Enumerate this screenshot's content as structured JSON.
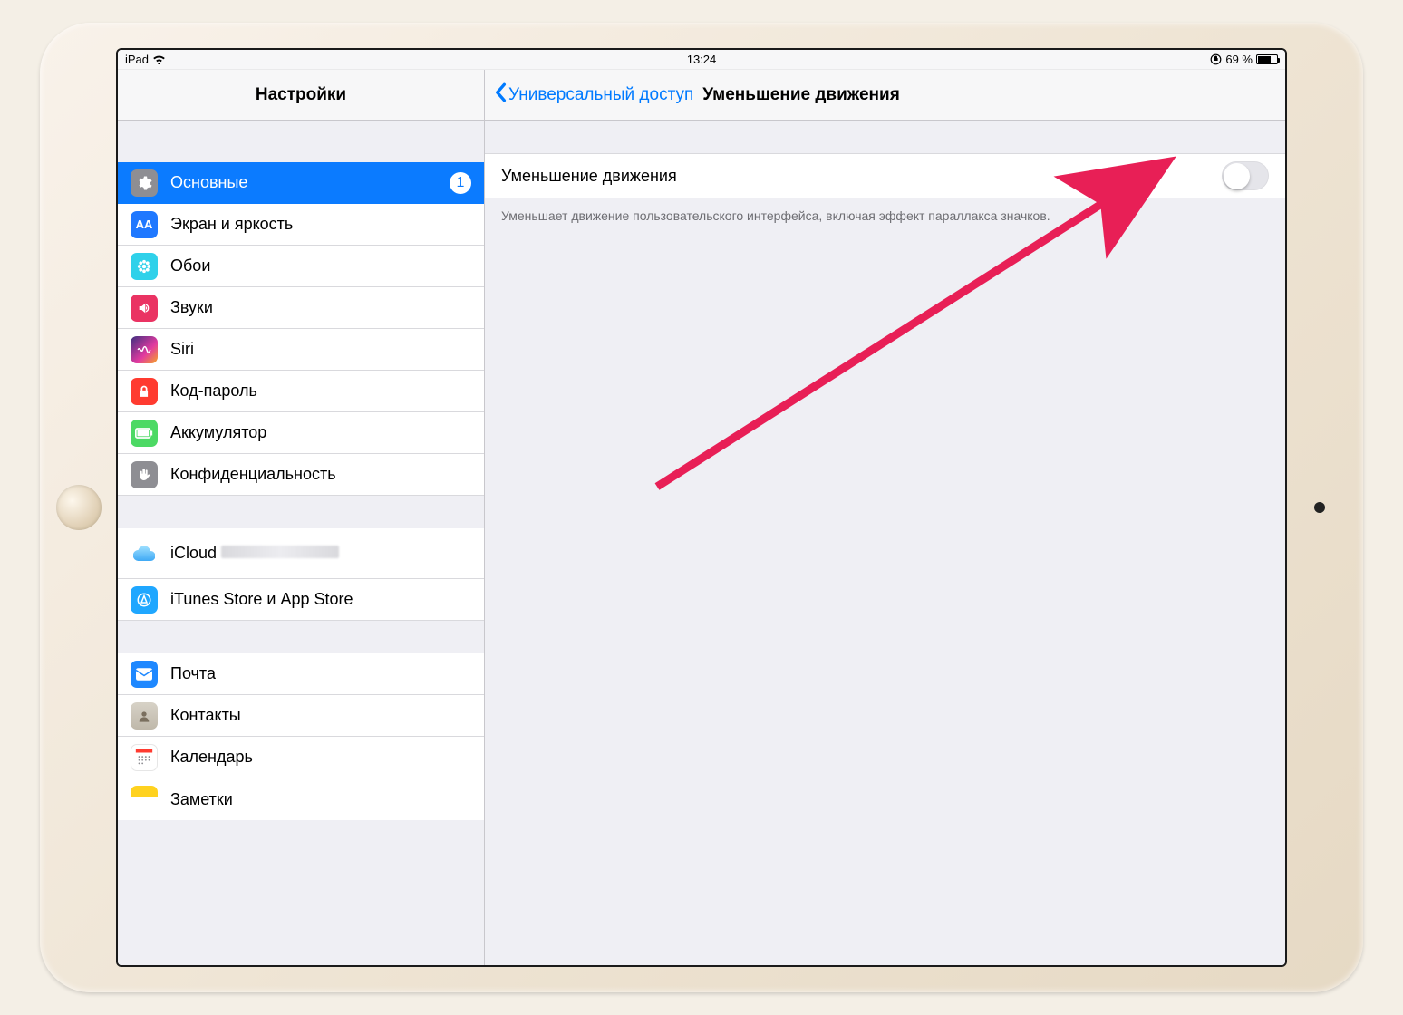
{
  "status": {
    "device": "iPad",
    "time": "13:24",
    "battery_pct": "69 %"
  },
  "sidebar": {
    "title": "Настройки",
    "items": {
      "general": "Основные",
      "general_badge": "1",
      "display": "Экран и яркость",
      "wallpaper": "Обои",
      "sounds": "Звуки",
      "siri": "Siri",
      "passcode": "Код-пароль",
      "battery": "Аккумулятор",
      "privacy": "Конфиденциальность",
      "icloud": "iCloud",
      "itunes": "iTunes Store и App Store",
      "mail": "Почта",
      "contacts": "Контакты",
      "calendar": "Календарь",
      "notes": "Заметки"
    }
  },
  "detail": {
    "back_label": "Универсальный доступ",
    "title": "Уменьшение движения",
    "toggle_label": "Уменьшение движения",
    "footer": "Уменьшает движение пользовательского интерфейса, включая эффект параллакса значков."
  }
}
